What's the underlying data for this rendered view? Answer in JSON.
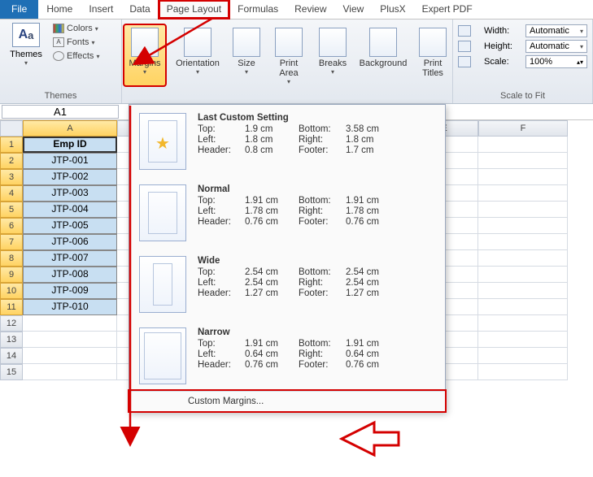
{
  "tabs": {
    "file": "File",
    "home": "Home",
    "insert": "Insert",
    "data": "Data",
    "page_layout": "Page Layout",
    "formulas": "Formulas",
    "review": "Review",
    "view": "View",
    "plusx": "PlusX",
    "expert_pdf": "Expert PDF"
  },
  "ribbon": {
    "themes": {
      "themes_label": "Themes",
      "colors": "Colors",
      "fonts": "Fonts",
      "effects": "Effects",
      "group_title": "Themes"
    },
    "page_setup": {
      "margins": "Margins",
      "orientation": "Orientation",
      "size": "Size",
      "print_area": "Print\nArea",
      "breaks": "Breaks",
      "background": "Background",
      "print_titles": "Print\nTitles"
    },
    "scale": {
      "width_label": "Width:",
      "height_label": "Height:",
      "scale_label": "Scale:",
      "width_value": "Automatic",
      "height_value": "Automatic",
      "scale_value": "100%",
      "group_title": "Scale to Fit"
    }
  },
  "namebox": "A1",
  "columns": {
    "A": "A",
    "E": "E",
    "F": "F"
  },
  "row_numbers": [
    "1",
    "2",
    "3",
    "4",
    "5",
    "6",
    "7",
    "8",
    "9",
    "10",
    "11",
    "12",
    "13",
    "14",
    "15"
  ],
  "table": {
    "header": "Emp ID",
    "rows": [
      "JTP-001",
      "JTP-002",
      "JTP-003",
      "JTP-004",
      "JTP-005",
      "JTP-006",
      "JTP-007",
      "JTP-008",
      "JTP-009",
      "JTP-010"
    ]
  },
  "margins_panel": {
    "presets": [
      {
        "title": "Last Custom Setting",
        "thumb": "star",
        "top": "1.9 cm",
        "bottom": "3.58 cm",
        "left": "1.8 cm",
        "right": "1.8 cm",
        "header": "0.8 cm",
        "footer": "1.7 cm"
      },
      {
        "title": "Normal",
        "thumb": "",
        "top": "1.91 cm",
        "bottom": "1.91 cm",
        "left": "1.78 cm",
        "right": "1.78 cm",
        "header": "0.76 cm",
        "footer": "0.76 cm"
      },
      {
        "title": "Wide",
        "thumb": "wide",
        "top": "2.54 cm",
        "bottom": "2.54 cm",
        "left": "2.54 cm",
        "right": "2.54 cm",
        "header": "1.27 cm",
        "footer": "1.27 cm"
      },
      {
        "title": "Narrow",
        "thumb": "narrow",
        "top": "1.91 cm",
        "bottom": "1.91 cm",
        "left": "0.64 cm",
        "right": "0.64 cm",
        "header": "0.76 cm",
        "footer": "0.76 cm"
      }
    ],
    "labels": {
      "top": "Top:",
      "bottom": "Bottom:",
      "left": "Left:",
      "right": "Right:",
      "header": "Header:",
      "footer": "Footer:"
    },
    "custom": "Custom Margins..."
  }
}
